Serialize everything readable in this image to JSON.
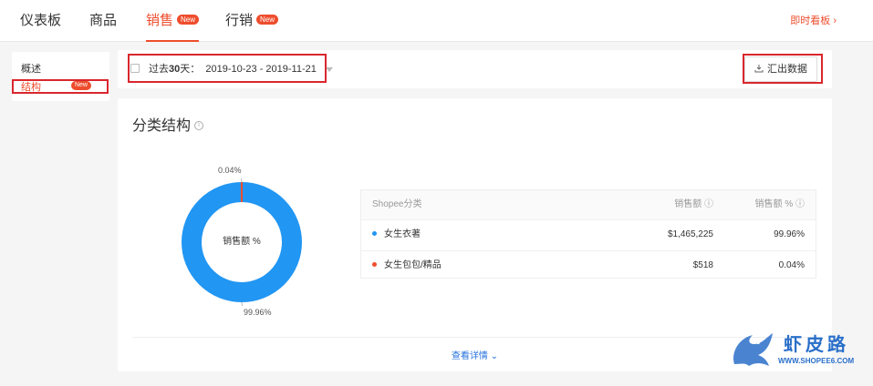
{
  "nav": {
    "tabs": [
      {
        "label": "仪表板",
        "badge": ""
      },
      {
        "label": "商品",
        "badge": ""
      },
      {
        "label": "销售",
        "badge": "New"
      },
      {
        "label": "行销",
        "badge": "New"
      }
    ],
    "realtime_label": "即时看板 ›"
  },
  "sidebar": {
    "items": [
      {
        "label": "概述",
        "badge": ""
      },
      {
        "label": "结构",
        "badge": "New"
      }
    ]
  },
  "toolbar": {
    "range_prefix": "过去",
    "range_days": "30",
    "range_suffix": "天：",
    "range_dates": "2019-10-23 - 2019-11-21",
    "export_label": "汇出数据",
    "icons": {
      "calendar": "calendar-icon",
      "export": "download-icon"
    }
  },
  "card": {
    "title": "分类结构",
    "donut_center_label": "销售额 %",
    "pct_small": "0.04%",
    "pct_large": "99.96%",
    "table": {
      "headers": [
        "Shopee分类",
        "销售额 ⓘ",
        "销售额 % ⓘ"
      ],
      "rows": [
        {
          "category": "女生衣著",
          "sales": "$1,465,225",
          "percent": "99.96%",
          "color": "#2196f3"
        },
        {
          "category": "女生包包/精品",
          "sales": "$518",
          "percent": "0.04%",
          "color": "#ee4d2d"
        }
      ]
    },
    "details_label": "查看详情 ⌄"
  },
  "colors": {
    "accent": "#ee4d2d",
    "primary_blue": "#2196f3",
    "link": "#2673dd"
  },
  "watermark": {
    "title": "虾皮路",
    "url": "WWW.SHOPEE6.COM"
  }
}
